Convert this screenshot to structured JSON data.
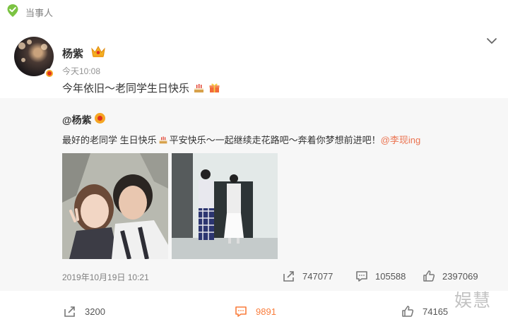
{
  "header": {
    "label": "当事人"
  },
  "post": {
    "author": "杨紫",
    "time": "今天10:08",
    "text": "今年依旧～老同学生日快乐"
  },
  "repost": {
    "author": "@杨紫",
    "text": "最好的老同学 生日快乐",
    "text2": "平安快乐～一起继续走花路吧～奔着你梦想前进吧！",
    "mention": "@李现ing",
    "date": "2019年10月19日 10:21",
    "shares": "747077",
    "comments": "105588",
    "likes": "2397069"
  },
  "stats": {
    "shares": "3200",
    "comments": "9891",
    "likes": "74165"
  },
  "watermark": "娱慧",
  "colors": {
    "accent": "#fa7d3c",
    "mention": "#eb7350",
    "repost_bg": "#f7f7f7",
    "verified": "#f5a623"
  }
}
